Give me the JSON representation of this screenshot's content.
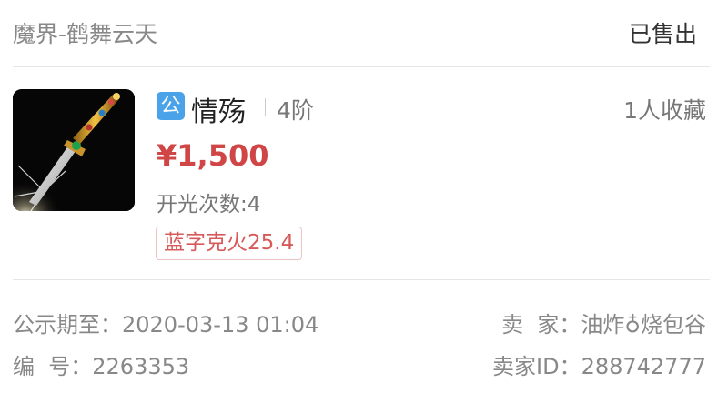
{
  "header": {
    "server_name": "魔界-鹤舞云天",
    "status": "已售出"
  },
  "item": {
    "icon": "sword-icon",
    "badge": "公",
    "name": "情殇",
    "tier": "4阶",
    "favorites": "1人收藏",
    "price": "¥1,500",
    "refine_label": "开光次数:",
    "refine_value": "4",
    "tag": "蓝字克火25.4"
  },
  "details": {
    "publicity_label": "公示期至：",
    "publicity_value": "2020-03-13 01:04",
    "seller_label": "卖  家：",
    "seller_value": "油炸♁烧包谷",
    "number_label": "编  号：",
    "number_value": "2263353",
    "seller_id_label": "卖家ID：",
    "seller_id_value": "288742777"
  },
  "colors": {
    "price": "#d04545",
    "badge": "#4aa3e8",
    "tag_text": "#d65a5a",
    "tag_border": "#ebc3c3"
  }
}
